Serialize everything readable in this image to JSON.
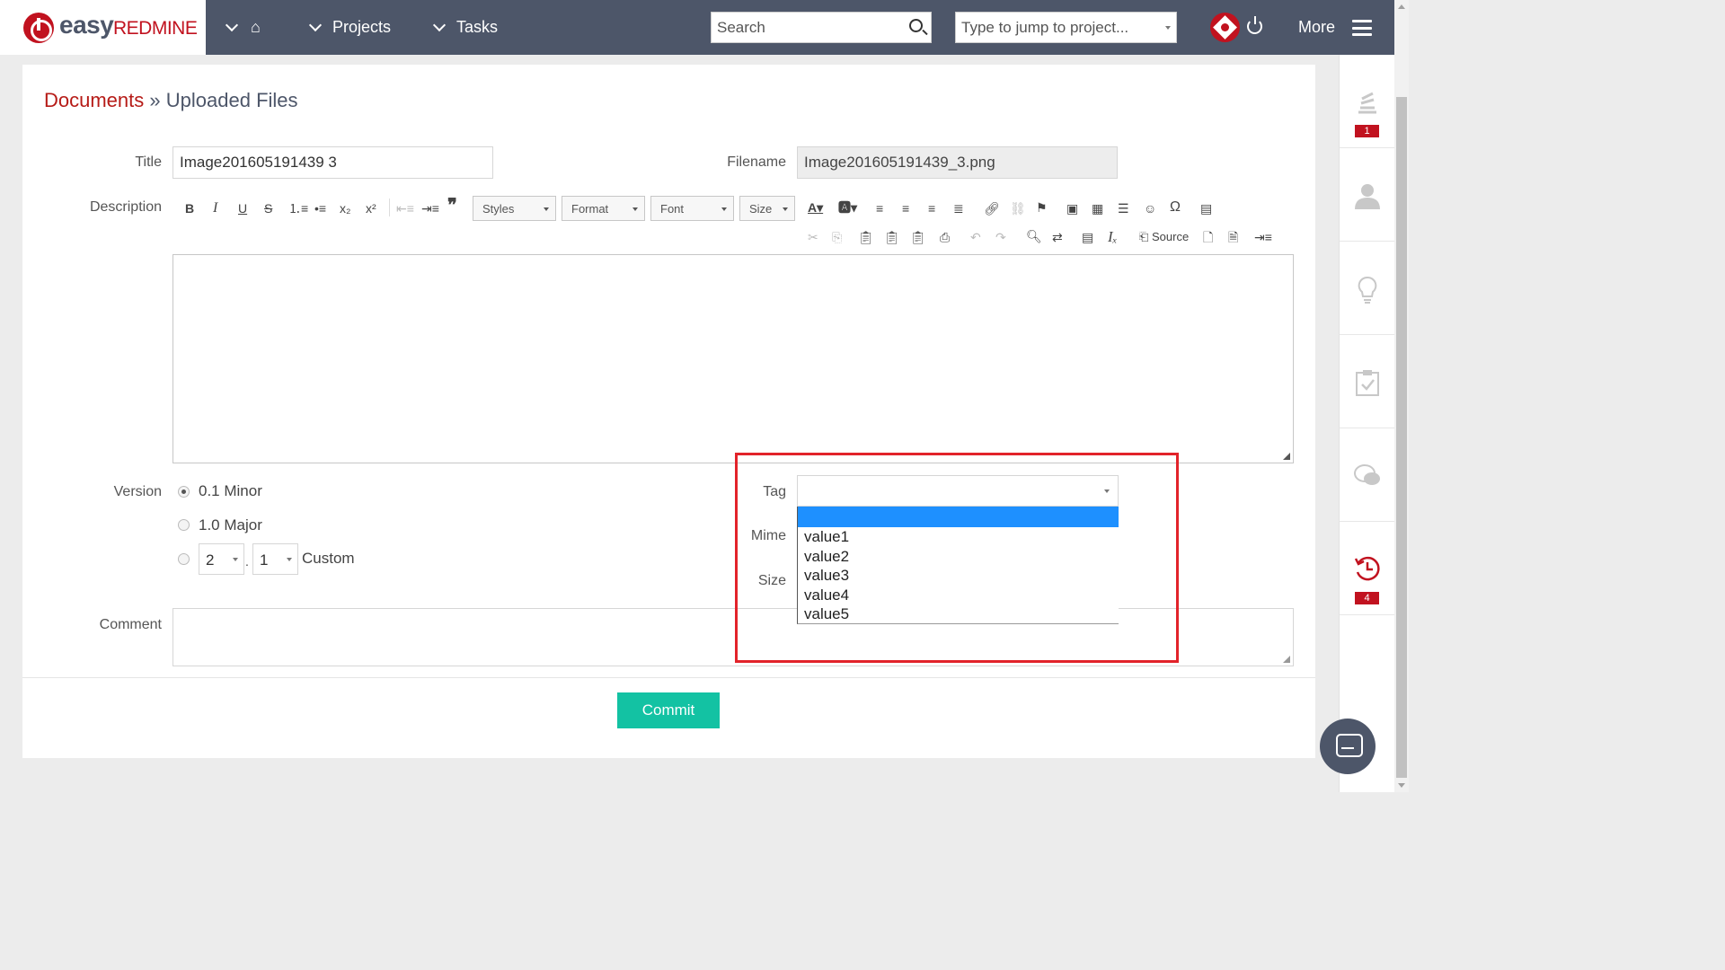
{
  "header": {
    "logo_easy": "easy",
    "logo_redmine": "REDMINE",
    "nav": [
      {
        "label": "Projects"
      },
      {
        "label": "Tasks"
      }
    ],
    "search_placeholder": "Search",
    "jump_placeholder": "Type to jump to project...",
    "more_label": "More"
  },
  "breadcrumb": {
    "link": "Documents",
    "separator": "»",
    "current": "Uploaded Files"
  },
  "form": {
    "title_label": "Title",
    "title_value": "Image201605191439 3",
    "filename_label": "Filename",
    "filename_value": "Image201605191439_3.png",
    "description_label": "Description",
    "version_label": "Version",
    "version_options": [
      {
        "label": "0.1 Minor",
        "checked": true
      },
      {
        "label": "1.0 Major",
        "checked": false
      },
      {
        "label": "Custom",
        "checked": false
      }
    ],
    "custom_major": "2",
    "custom_minor": "1",
    "version_dot": ".",
    "comment_label": "Comment",
    "tag_label": "Tag",
    "mime_label": "Mime",
    "size_label": "Size",
    "tag_options": [
      "",
      "value1",
      "value2",
      "value3",
      "value4",
      "value5"
    ],
    "commit_label": "Commit"
  },
  "editor_toolbar": {
    "combos": [
      "Styles",
      "Format",
      "Font",
      "Size"
    ],
    "source_label": "Source"
  },
  "sidebar": {
    "badges": [
      "1",
      "4"
    ]
  },
  "colors": {
    "header_bg": "#4d5669",
    "brand_red": "#c1121f",
    "commit_green": "#13c2a3",
    "selection_blue": "#1e90ff",
    "highlight_frame": "#e2232a"
  }
}
